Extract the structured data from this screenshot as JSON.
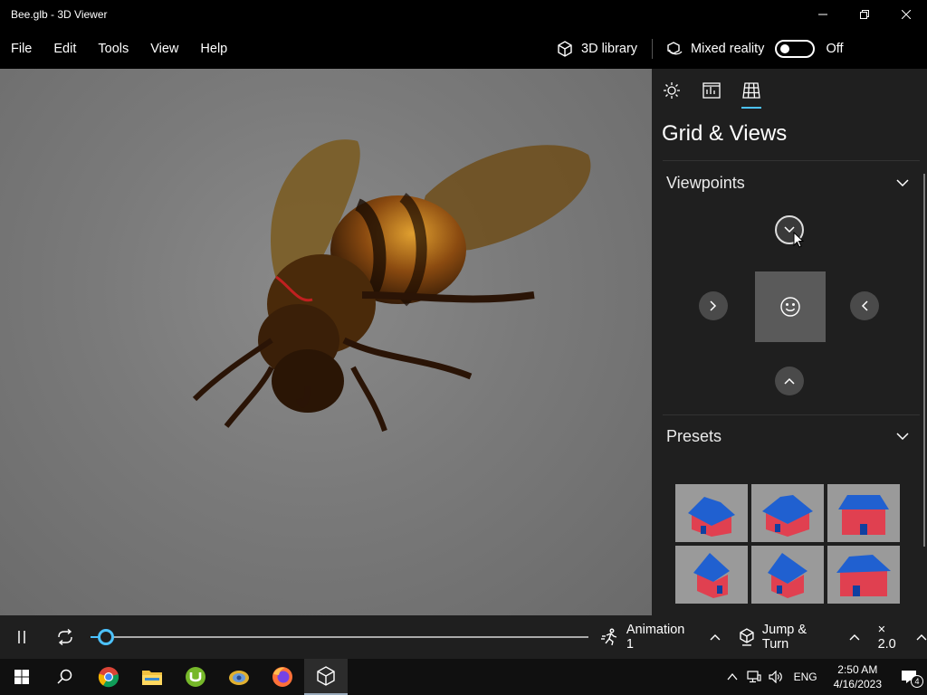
{
  "window": {
    "title": "Bee.glb - 3D Viewer"
  },
  "menu": {
    "items": [
      "File",
      "Edit",
      "Tools",
      "View",
      "Help"
    ],
    "library_label": "3D library",
    "mixed_reality_label": "Mixed reality",
    "toggle_state": "Off"
  },
  "panel": {
    "tabs": [
      "lighting-icon",
      "stats-icon",
      "grid-icon"
    ],
    "title": "Grid & Views",
    "viewpoints_label": "Viewpoints",
    "presets_label": "Presets"
  },
  "animation": {
    "progress": 0.03,
    "name": "Animation 1",
    "mode": "Jump & Turn",
    "speed": "× 2.0"
  },
  "taskbar": {
    "apps": [
      "windows-start",
      "search",
      "chrome",
      "file-explorer",
      "utorrent",
      "tool-app",
      "firefox",
      "3d-viewer"
    ],
    "lang": "ENG",
    "time": "2:50 AM",
    "date": "4/16/2023",
    "notifications": "4"
  },
  "colors": {
    "accent": "#4cc2ff",
    "panel": "#1f1f1f",
    "viewport": "#7a7a7a"
  }
}
